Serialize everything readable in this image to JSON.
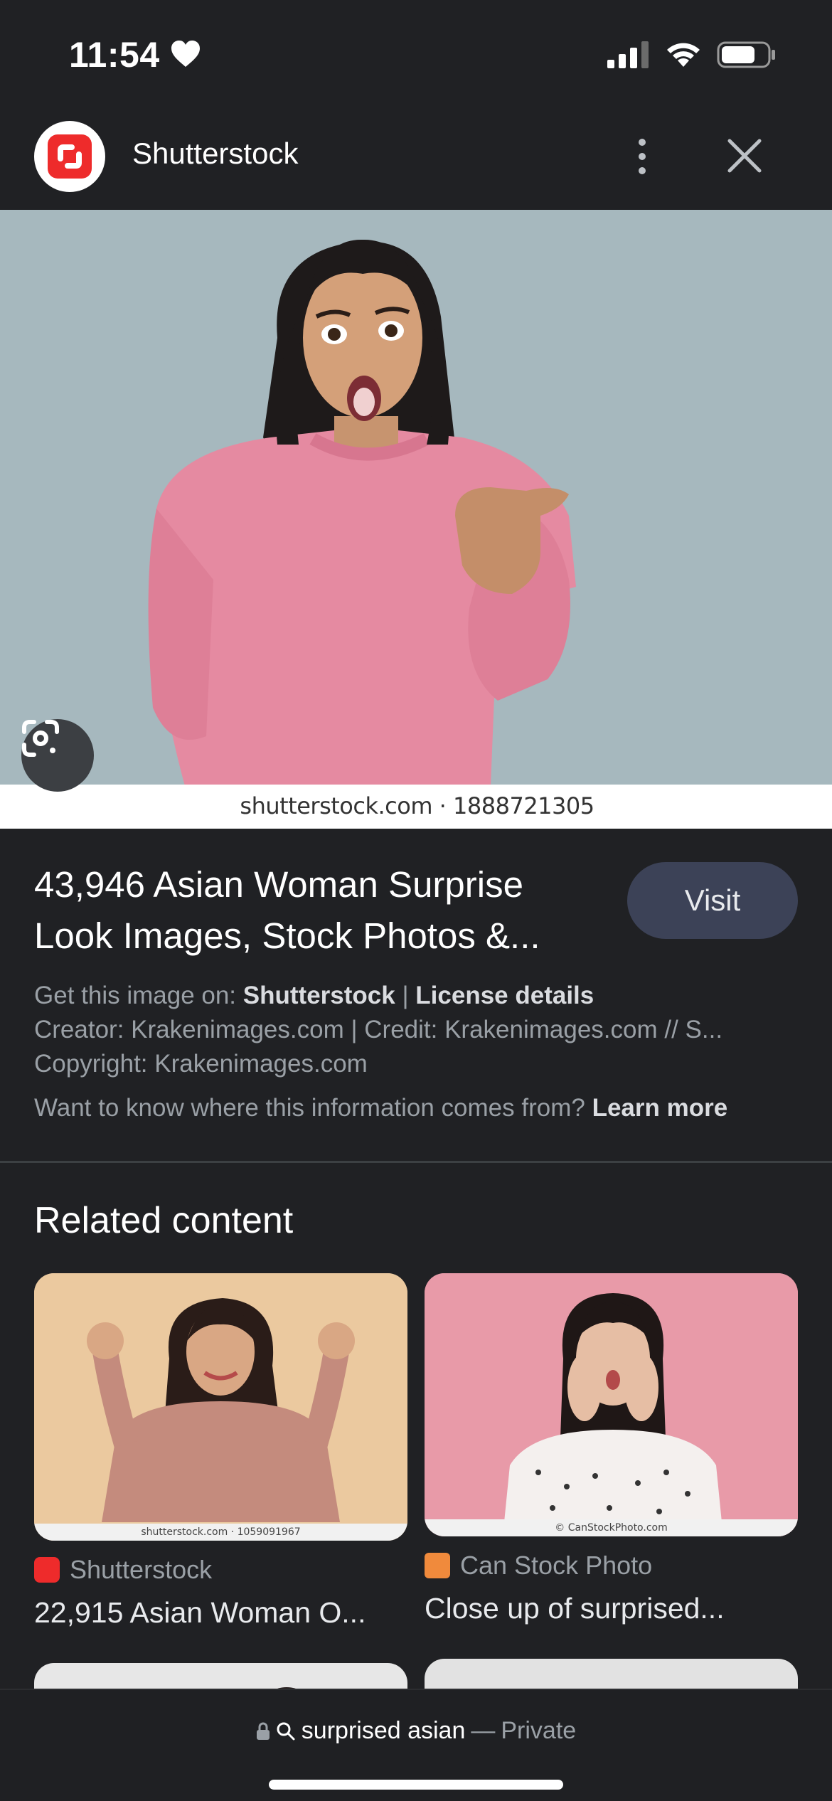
{
  "status_bar": {
    "time": "11:54"
  },
  "header": {
    "site_name": "Shutterstock"
  },
  "main_image": {
    "watermark": "shutterstock.com · 1888721305"
  },
  "result": {
    "title": "43,946 Asian Woman Surprise Look Images, Stock Photos &...",
    "visit_label": "Visit",
    "get_image_prefix": "Get this image on:",
    "get_image_source": "Shutterstock",
    "separator": "|",
    "license_details": "License details",
    "creator_line": "Creator: Krakenimages.com | Credit: Krakenimages.com // S...",
    "copyright_line": "Copyright: Krakenimages.com",
    "info_question": "Want to know where this information comes from?",
    "learn_more": "Learn more"
  },
  "related": {
    "heading": "Related content",
    "cards": [
      {
        "source": "Shutterstock",
        "title": "22,915 Asian Woman O...",
        "watermark": "shutterstock.com · 1059091967",
        "favicon": "shutterstock-icon",
        "accent": "#ee2b2b"
      },
      {
        "source": "Can Stock Photo",
        "title": "Close up of surprised...",
        "watermark": "© CanStockPhoto.com",
        "favicon": "canstock-icon",
        "accent": "#f08a3c"
      }
    ]
  },
  "bottom_bar": {
    "query": "surprised asian",
    "dash": "—",
    "mode": "Private"
  }
}
